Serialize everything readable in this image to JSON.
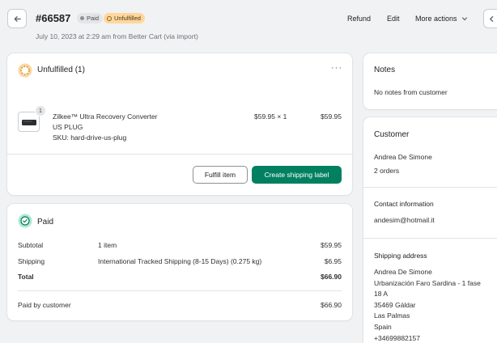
{
  "header": {
    "order_number": "#66587",
    "badge_paid": "Paid",
    "badge_unfulfilled": "Unfulfilled",
    "subtitle": "July 10, 2023 at 2:29 am from Better Cart (via import)",
    "refund": "Refund",
    "edit": "Edit",
    "more_actions": "More actions"
  },
  "fulfillment": {
    "title": "Unfulfilled (1)",
    "item": {
      "quantity_badge": "1",
      "name": "Zilkee™ Ultra Recovery Converter",
      "variant": "US PLUG",
      "sku": "SKU: hard-drive-us-plug",
      "price_qty": "$59.95 × 1",
      "total": "$59.95"
    },
    "fulfill_button": "Fulfill item",
    "create_label_button": "Create shipping label"
  },
  "payment": {
    "title": "Paid",
    "rows": [
      {
        "label": "Subtotal",
        "detail": "1 item",
        "amount": "$59.95"
      },
      {
        "label": "Shipping",
        "detail": "International Tracked Shipping (8-15 Days) (0.275 kg)",
        "amount": "$6.95"
      },
      {
        "label": "Total",
        "detail": "",
        "amount": "$66.90"
      }
    ],
    "paid_by_label": "Paid by customer",
    "paid_by_amount": "$66.90"
  },
  "notes": {
    "title": "Notes",
    "text": "No notes from customer"
  },
  "customer": {
    "title": "Customer",
    "name": "Andrea De Simone",
    "orders": "2 orders",
    "contact_title": "Contact information",
    "email": "andesim@hotmail.it",
    "shipping_title": "Shipping address",
    "address": [
      "Andrea De Simone",
      "Urbanización Faro Sardina - 1 fase",
      "18 A",
      "35469 Gáldar",
      "Las Palmas",
      "Spain",
      "+34699882157"
    ]
  },
  "colors": {
    "primary": "#008060",
    "link": "#2c6ecb",
    "unfulfilled_badge": "#ffd79d",
    "paid_icon": "#007f5f"
  }
}
